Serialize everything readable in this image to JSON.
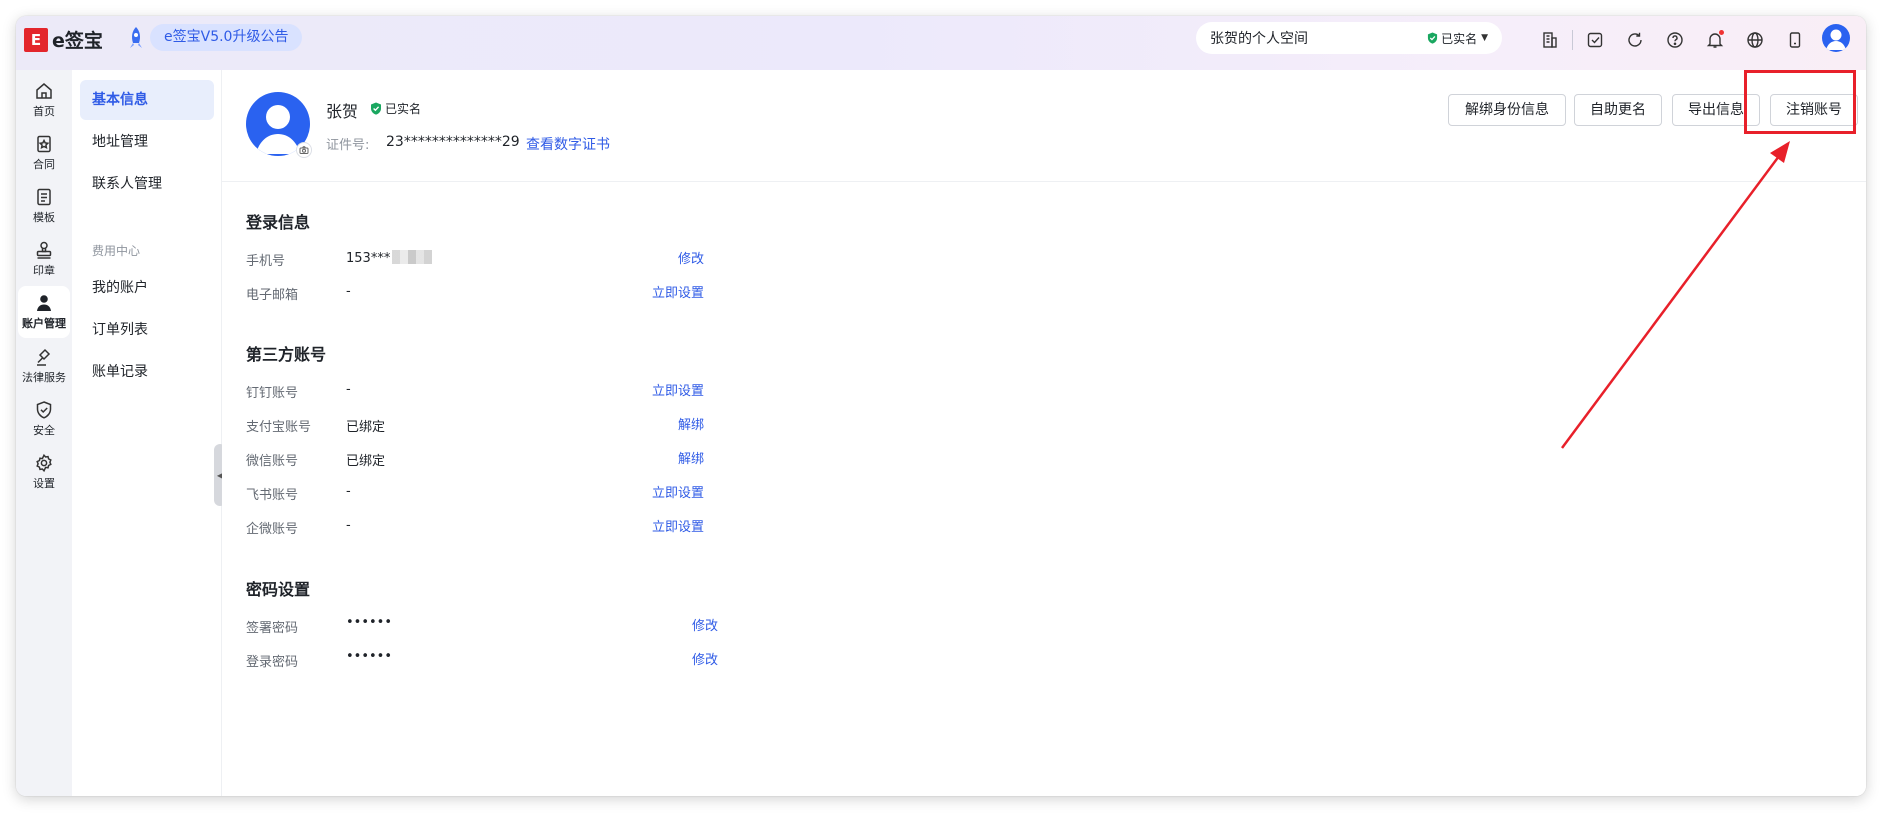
{
  "topbar": {
    "logo_mark": "E",
    "logo_text": "e签宝",
    "announcement": "e签宝V5.0升级公告",
    "space_name": "张贺的个人空间",
    "verify_status": "已实名"
  },
  "rail": {
    "items": [
      {
        "label": "首页",
        "icon": "home-icon"
      },
      {
        "label": "合同",
        "icon": "contract-icon"
      },
      {
        "label": "模板",
        "icon": "template-icon"
      },
      {
        "label": "印章",
        "icon": "seal-icon"
      },
      {
        "label": "账户管理",
        "icon": "user-icon"
      },
      {
        "label": "法律服务",
        "icon": "gavel-icon"
      },
      {
        "label": "安全",
        "icon": "shield-icon"
      },
      {
        "label": "设置",
        "icon": "gear-icon"
      }
    ]
  },
  "submenu": {
    "items": [
      "基本信息",
      "地址管理",
      "联系人管理"
    ],
    "group_title": "费用中心",
    "group_items": [
      "我的账户",
      "订单列表",
      "账单记录"
    ]
  },
  "profile": {
    "name": "张贺",
    "verified": "已实名",
    "id_label": "证件号:",
    "id_value": "23**************29",
    "cert_link": "查看数字证书",
    "buttons": [
      "解绑身份信息",
      "自助更名",
      "导出信息",
      "注销账号"
    ]
  },
  "login_info": {
    "title": "登录信息",
    "rows": [
      {
        "label": "手机号",
        "value": "153***",
        "action": "修改"
      },
      {
        "label": "电子邮箱",
        "value": "-",
        "action": "立即设置"
      }
    ]
  },
  "third_party": {
    "title": "第三方账号",
    "rows": [
      {
        "label": "钉钉账号",
        "value": "-",
        "action": "立即设置"
      },
      {
        "label": "支付宝账号",
        "value": "已绑定",
        "action": "解绑"
      },
      {
        "label": "微信账号",
        "value": "已绑定",
        "action": "解绑"
      },
      {
        "label": "飞书账号",
        "value": "-",
        "action": "立即设置"
      },
      {
        "label": "企微账号",
        "value": "-",
        "action": "立即设置"
      }
    ]
  },
  "password": {
    "title": "密码设置",
    "rows": [
      {
        "label": "签署密码",
        "value": "••••••",
        "action": "修改"
      },
      {
        "label": "登录密码",
        "value": "••••••",
        "action": "修改"
      }
    ]
  },
  "colors": {
    "accent": "#2f5be6",
    "annotation": "#e8202a",
    "verified_green": "#1aa760"
  }
}
